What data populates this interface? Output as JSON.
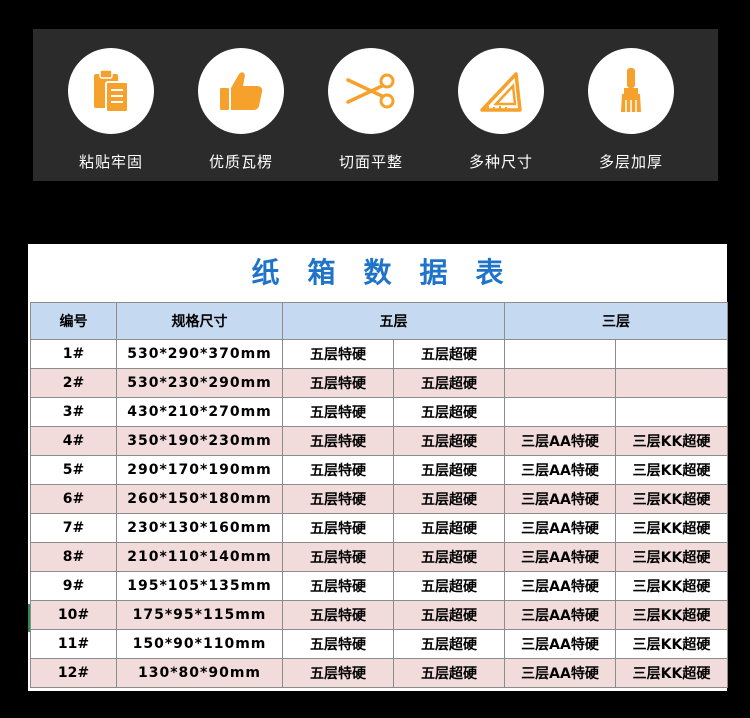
{
  "features": [
    {
      "icon": "clipboard-icon",
      "label": "粘贴牢固"
    },
    {
      "icon": "thumbs-up-icon",
      "label": "优质瓦楞"
    },
    {
      "icon": "scissors-icon",
      "label": "切面平整"
    },
    {
      "icon": "set-square-icon",
      "label": "多种尺寸"
    },
    {
      "icon": "brush-icon",
      "label": "多层加厚"
    }
  ],
  "colors": {
    "icon_orange": "#f5a12c",
    "title_blue": "#1f74c9",
    "header_bg": "#c5d9f1",
    "pink_row": "#f2dcdb"
  },
  "table": {
    "title": "纸箱数据表",
    "headers": {
      "id": "编号",
      "size": "规格尺寸",
      "five": "五层",
      "three": "三层"
    },
    "rows": [
      {
        "id": "1#",
        "size": "530*290*370mm",
        "five_a": "五层特硬",
        "five_b": "五层超硬",
        "three_a": "",
        "three_b": ""
      },
      {
        "id": "2#",
        "size": "530*230*290mm",
        "five_a": "五层特硬",
        "five_b": "五层超硬",
        "three_a": "",
        "three_b": ""
      },
      {
        "id": "3#",
        "size": "430*210*270mm",
        "five_a": "五层特硬",
        "five_b": "五层超硬",
        "three_a": "",
        "three_b": ""
      },
      {
        "id": "4#",
        "size": "350*190*230mm",
        "five_a": "五层特硬",
        "five_b": "五层超硬",
        "three_a": "三层AA特硬",
        "three_b": "三层KK超硬"
      },
      {
        "id": "5#",
        "size": "290*170*190mm",
        "five_a": "五层特硬",
        "five_b": "五层超硬",
        "three_a": "三层AA特硬",
        "three_b": "三层KK超硬"
      },
      {
        "id": "6#",
        "size": "260*150*180mm",
        "five_a": "五层特硬",
        "five_b": "五层超硬",
        "three_a": "三层AA特硬",
        "three_b": "三层KK超硬"
      },
      {
        "id": "7#",
        "size": "230*130*160mm",
        "five_a": "五层特硬",
        "five_b": "五层超硬",
        "three_a": "三层AA特硬",
        "three_b": "三层KK超硬"
      },
      {
        "id": "8#",
        "size": "210*110*140mm",
        "five_a": "五层特硬",
        "five_b": "五层超硬",
        "three_a": "三层AA特硬",
        "three_b": "三层KK超硬"
      },
      {
        "id": "9#",
        "size": "195*105*135mm",
        "five_a": "五层特硬",
        "five_b": "五层超硬",
        "three_a": "三层AA特硬",
        "three_b": "三层KK超硬"
      },
      {
        "id": "10#",
        "size": "175*95*115mm",
        "five_a": "五层特硬",
        "five_b": "五层超硬",
        "three_a": "三层AA特硬",
        "three_b": "三层KK超硬"
      },
      {
        "id": "11#",
        "size": "150*90*110mm",
        "five_a": "五层特硬",
        "five_b": "五层超硬",
        "three_a": "三层AA特硬",
        "three_b": "三层KK超硬"
      },
      {
        "id": "12#",
        "size": "130*80*90mm",
        "five_a": "五层特硬",
        "five_b": "五层超硬",
        "three_a": "三层AA特硬",
        "three_b": "三层KK超硬"
      }
    ]
  }
}
